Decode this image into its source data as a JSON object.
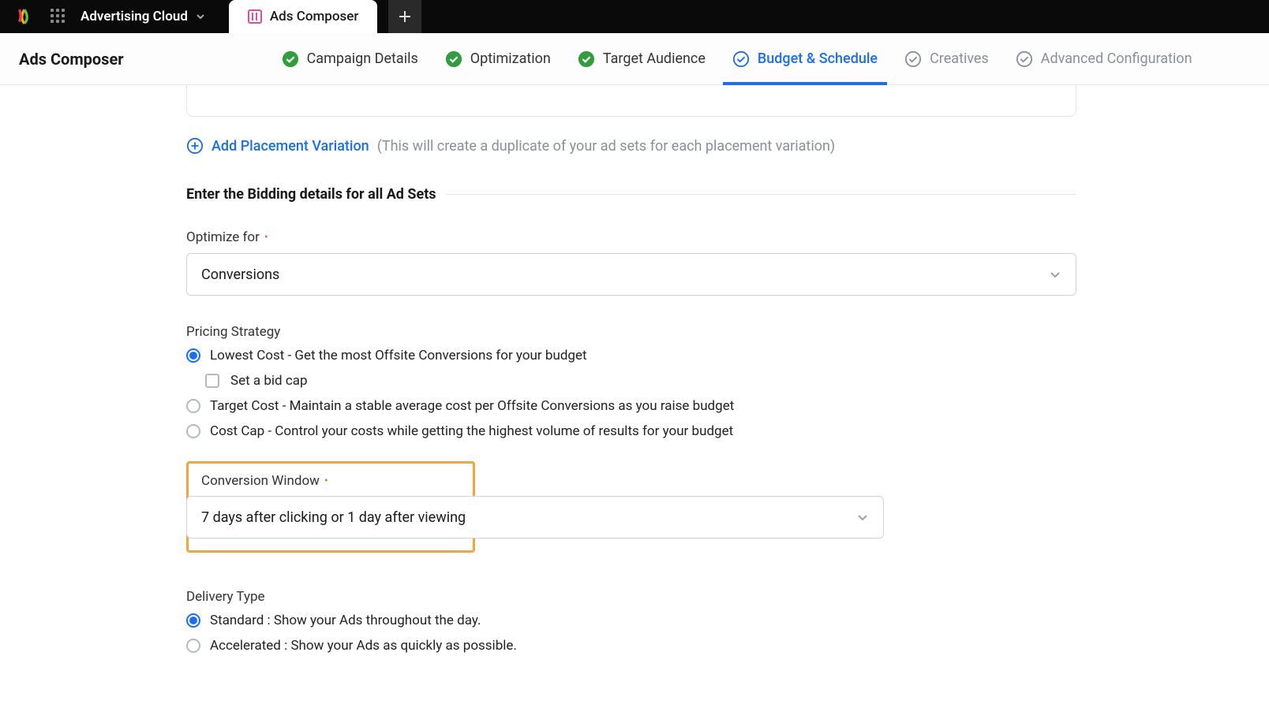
{
  "topbar": {
    "product": "Advertising Cloud",
    "tab_label": "Ads Composer"
  },
  "page_title": "Ads Composer",
  "steps": [
    {
      "label": "Campaign Details",
      "state": "done"
    },
    {
      "label": "Optimization",
      "state": "done"
    },
    {
      "label": "Target Audience",
      "state": "done"
    },
    {
      "label": "Budget & Schedule",
      "state": "active"
    },
    {
      "label": "Creatives",
      "state": "pending"
    },
    {
      "label": "Advanced Configuration",
      "state": "pending"
    }
  ],
  "add_placement": {
    "link": "Add Placement Variation",
    "note": "(This will create a duplicate of your ad sets for each placement variation)"
  },
  "bidding_header": "Enter the Bidding details for all Ad Sets",
  "optimize_for": {
    "label": "Optimize for",
    "value": "Conversions"
  },
  "pricing": {
    "label": "Pricing Strategy",
    "options": [
      "Lowest Cost - Get the most Offsite Conversions for your budget",
      "Target Cost - Maintain a stable average cost per Offsite Conversions as you raise budget",
      "Cost Cap - Control your costs while getting the highest volume of results for your budget"
    ],
    "bid_cap_label": "Set a bid cap",
    "selected": 0
  },
  "conversion_window": {
    "label": "Conversion Window",
    "value": "7 days after clicking or 1 day after viewing"
  },
  "delivery": {
    "label": "Delivery Type",
    "options": [
      "Standard : Show your Ads throughout the day.",
      "Accelerated : Show your Ads as quickly as possible."
    ],
    "selected": 0
  }
}
